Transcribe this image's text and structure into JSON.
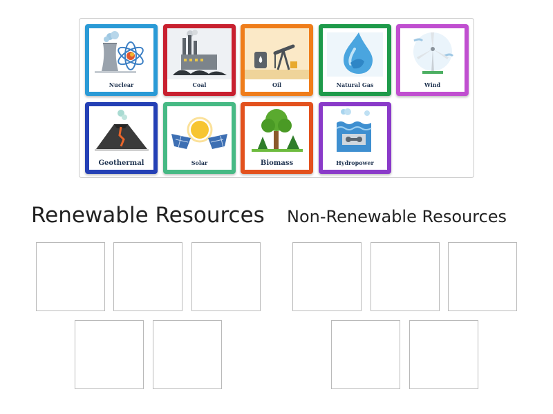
{
  "tray": {
    "cards": [
      {
        "id": "nuclear",
        "label": "Nuclear",
        "border": "#2a9ad6",
        "icon": "nuclear-plant-icon"
      },
      {
        "id": "coal",
        "label": "Coal",
        "border": "#c8202f",
        "icon": "coal-factory-icon"
      },
      {
        "id": "oil",
        "label": "Oil",
        "border": "#ef7d1a",
        "icon": "oil-pump-icon"
      },
      {
        "id": "natural-gas",
        "label": "Natural Gas",
        "border": "#1e9a4a",
        "icon": "gas-drop-icon"
      },
      {
        "id": "wind",
        "label": "Wind",
        "border": "#c04fd0",
        "icon": "wind-turbine-icon"
      },
      {
        "id": "geothermal",
        "label": "Geothermal",
        "border": "#2440b5",
        "icon": "volcano-icon"
      },
      {
        "id": "solar",
        "label": "Solar",
        "border": "#46b984",
        "icon": "solar-panel-icon"
      },
      {
        "id": "biomass",
        "label": "Biomass",
        "border": "#e3511d",
        "icon": "trees-icon"
      },
      {
        "id": "hydropower",
        "label": "Hydropower",
        "border": "#8a3ac9",
        "icon": "hydro-dam-icon"
      }
    ]
  },
  "groups": {
    "renewable": {
      "title": "Renewable Resources",
      "slots": 5
    },
    "non_renewable": {
      "title": "Non-Renewable Resources",
      "slots": 5
    }
  }
}
